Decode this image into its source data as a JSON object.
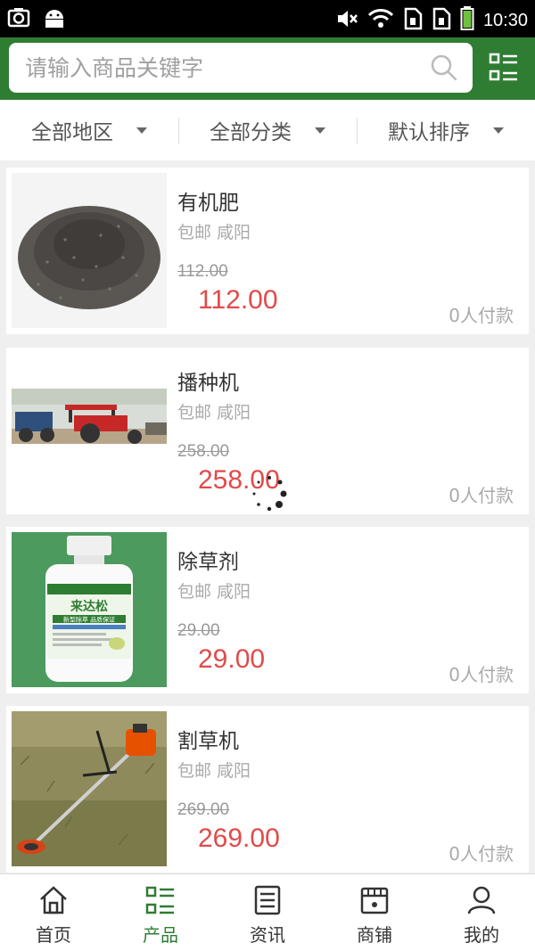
{
  "status_bar": {
    "time": "10:30",
    "icons": [
      "camera-icon",
      "android-icon",
      "mute-icon",
      "wifi-icon",
      "sim1-icon",
      "sim2-icon",
      "battery-icon"
    ]
  },
  "search": {
    "placeholder": "请输入商品关键字"
  },
  "filters": [
    {
      "label": "全部地区"
    },
    {
      "label": "全部分类"
    },
    {
      "label": "默认排序"
    }
  ],
  "products": [
    {
      "title": "有机肥",
      "location": "包邮 咸阳",
      "old_price": "112.00",
      "price": "112.00",
      "paid": "0人付款",
      "image": "fertilizer"
    },
    {
      "title": "播种机",
      "location": "包邮 咸阳",
      "old_price": "258.00",
      "price": "258.00",
      "paid": "0人付款",
      "image": "tractor"
    },
    {
      "title": "除草剂",
      "location": "包邮 咸阳",
      "old_price": "29.00",
      "price": "29.00",
      "paid": "0人付款",
      "image": "herbicide-bottle"
    },
    {
      "title": "割草机",
      "location": "包邮 咸阳",
      "old_price": "269.00",
      "price": "269.00",
      "paid": "0人付款",
      "image": "grass-trimmer"
    }
  ],
  "bottle_label": {
    "brand": "来达松",
    "slogan": "新型除草 品质保证"
  },
  "nav": [
    {
      "label": "首页",
      "icon": "home-icon"
    },
    {
      "label": "产品",
      "icon": "product-list-icon",
      "active": true
    },
    {
      "label": "资讯",
      "icon": "news-icon"
    },
    {
      "label": "商铺",
      "icon": "shop-icon"
    },
    {
      "label": "我的",
      "icon": "user-icon"
    }
  ],
  "colors": {
    "brand": "#2e7d32",
    "price": "#e24a4a"
  }
}
